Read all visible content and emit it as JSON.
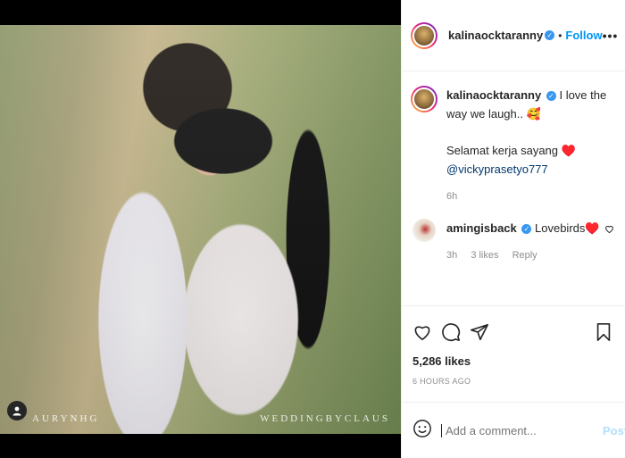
{
  "media": {
    "watermark_left": "AURYNHG",
    "watermark_right": "WEDDINGBYCLAUS",
    "tag_icon": "user-tag-icon"
  },
  "post": {
    "username": "kalinaocktaranny",
    "verified": true,
    "separator": "•",
    "follow_label": "Follow",
    "more_label": "•••"
  },
  "caption": {
    "username": "kalinaocktaranny",
    "line1": "I love the way we laugh.. 🥰",
    "line2": "Selamat kerja sayang ♥️",
    "mention": "@vickyprasetyo777",
    "time": "6h"
  },
  "comment": {
    "username": "amingisback",
    "text": "Lovebirds♥️",
    "time": "3h",
    "likes": "3 likes",
    "reply": "Reply"
  },
  "stats": {
    "likes": "5,286 likes",
    "ago": "6 HOURS AGO"
  },
  "composer": {
    "placeholder": "Add a comment...",
    "post_label": "Post"
  },
  "colors": {
    "accent": "#0095f6",
    "verified": "#3897f0",
    "muted": "#8e8e8e"
  }
}
